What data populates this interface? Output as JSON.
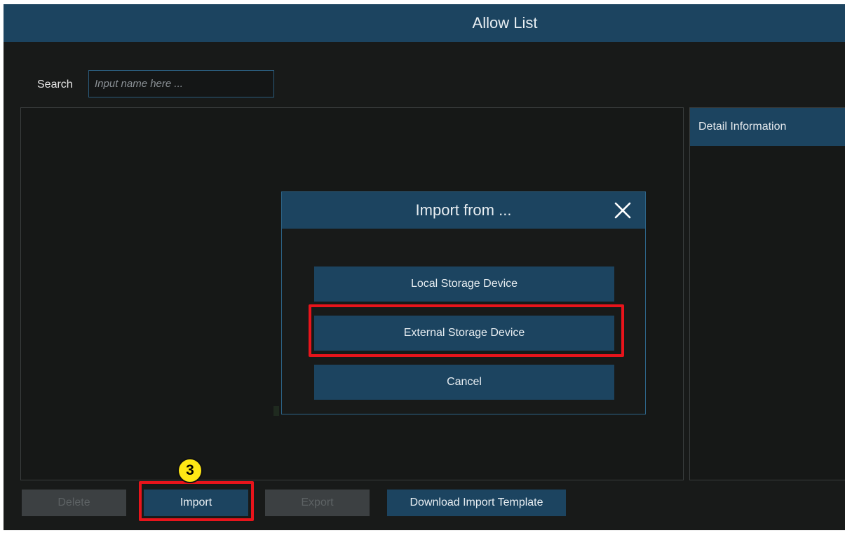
{
  "window": {
    "title": "Allow List"
  },
  "search": {
    "label": "Search",
    "placeholder": "Input name here ...",
    "value": ""
  },
  "detail_panel": {
    "title": "Detail Information"
  },
  "dialog": {
    "title": "Import from ...",
    "close_icon": "close-icon",
    "options": [
      {
        "label": "Local Storage Device"
      },
      {
        "label": "External Storage Device"
      },
      {
        "label": "Cancel"
      }
    ]
  },
  "toolbar": {
    "delete_label": "Delete",
    "import_label": "Import",
    "export_label": "Export",
    "download_template_label": "Download Import Template"
  },
  "annotations": {
    "step_number": "3",
    "highlight_color": "#e8141b",
    "badge_color": "#ffe815"
  },
  "colors": {
    "accent": "#1c4460",
    "background": "#181a19",
    "disabled_button": "#3c4042"
  }
}
